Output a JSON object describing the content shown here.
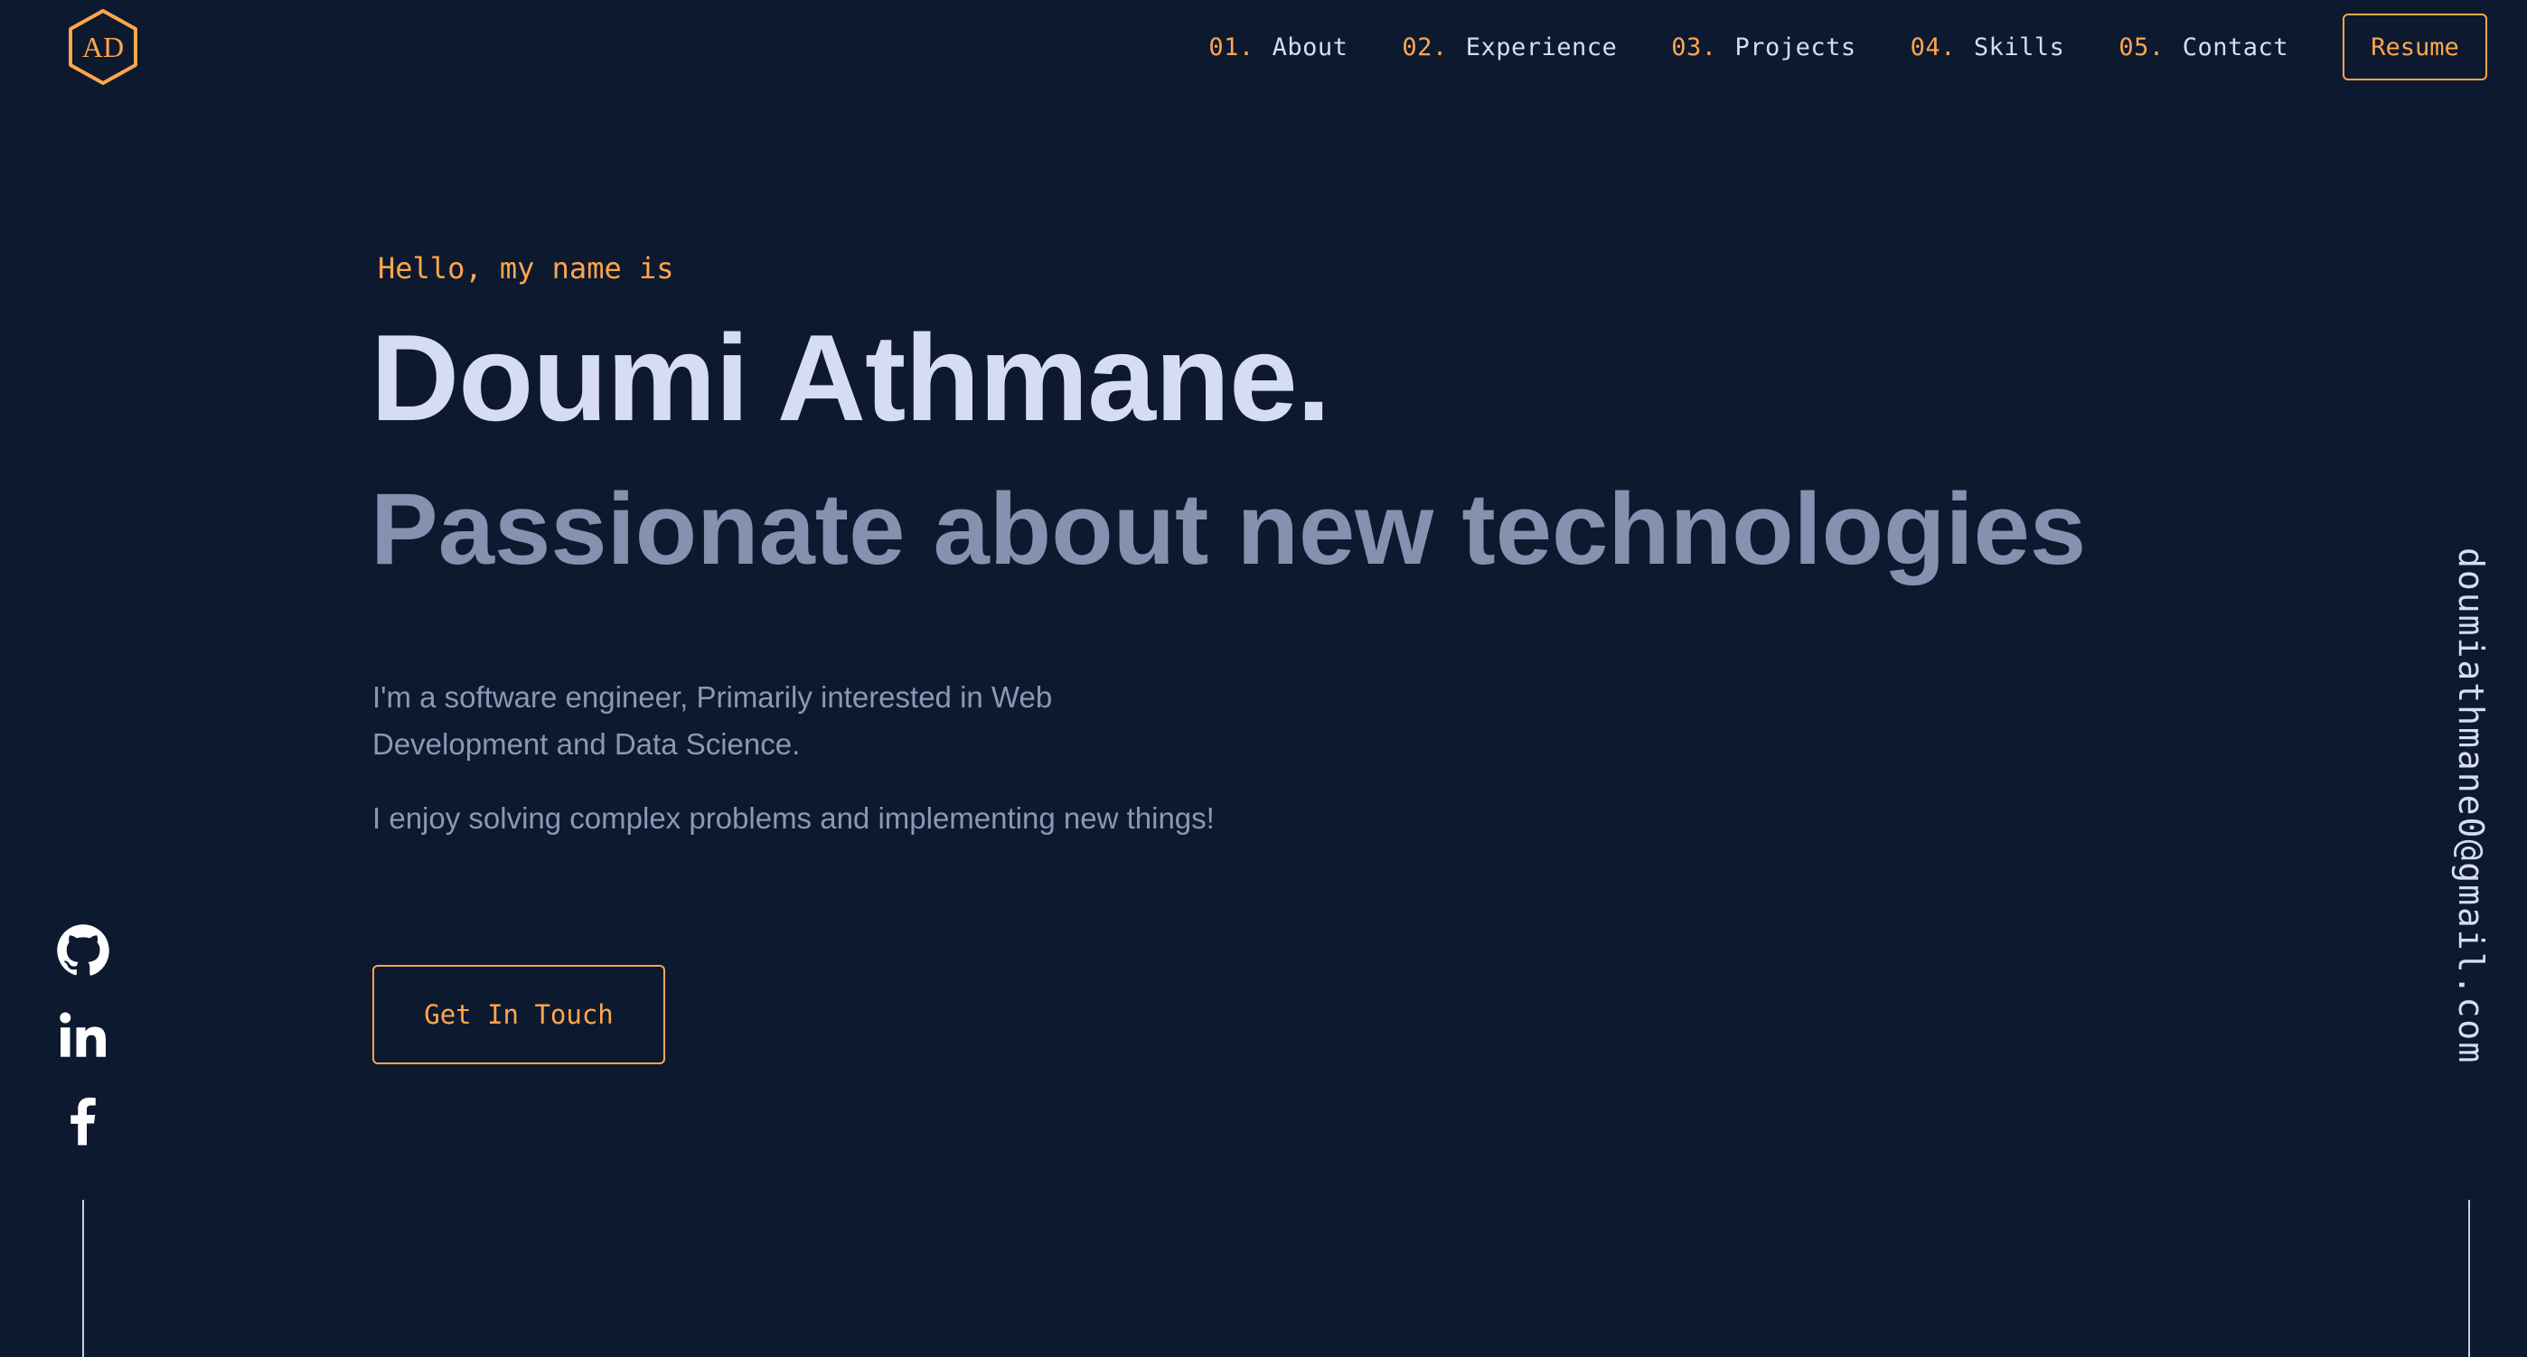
{
  "logo": {
    "text": "AD",
    "icon": "hexagon-logo"
  },
  "nav": {
    "items": [
      {
        "num": "01.",
        "label": "About"
      },
      {
        "num": "02.",
        "label": "Experience"
      },
      {
        "num": "03.",
        "label": "Projects"
      },
      {
        "num": "04.",
        "label": "Skills"
      },
      {
        "num": "05.",
        "label": "Contact"
      }
    ],
    "resume_label": "Resume"
  },
  "hero": {
    "greeting": "Hello, my name is",
    "name": "Doumi Athmane.",
    "tagline": "Passionate about new technologies",
    "bio": "I'm a software engineer, Primarily interested in Web Development and Data Science.",
    "bio2": "I enjoy solving complex problems and implementing new things!",
    "cta_label": "Get In Touch"
  },
  "social": {
    "icons": [
      "github-icon",
      "linkedin-icon",
      "facebook-icon"
    ]
  },
  "email": "doumiathmane0@gmail.com",
  "colors": {
    "background": "#0d192f",
    "accent": "#ffa64d",
    "heading": "#d7dcf5",
    "subheading": "#8890b0",
    "body_text": "#8f96b5"
  }
}
